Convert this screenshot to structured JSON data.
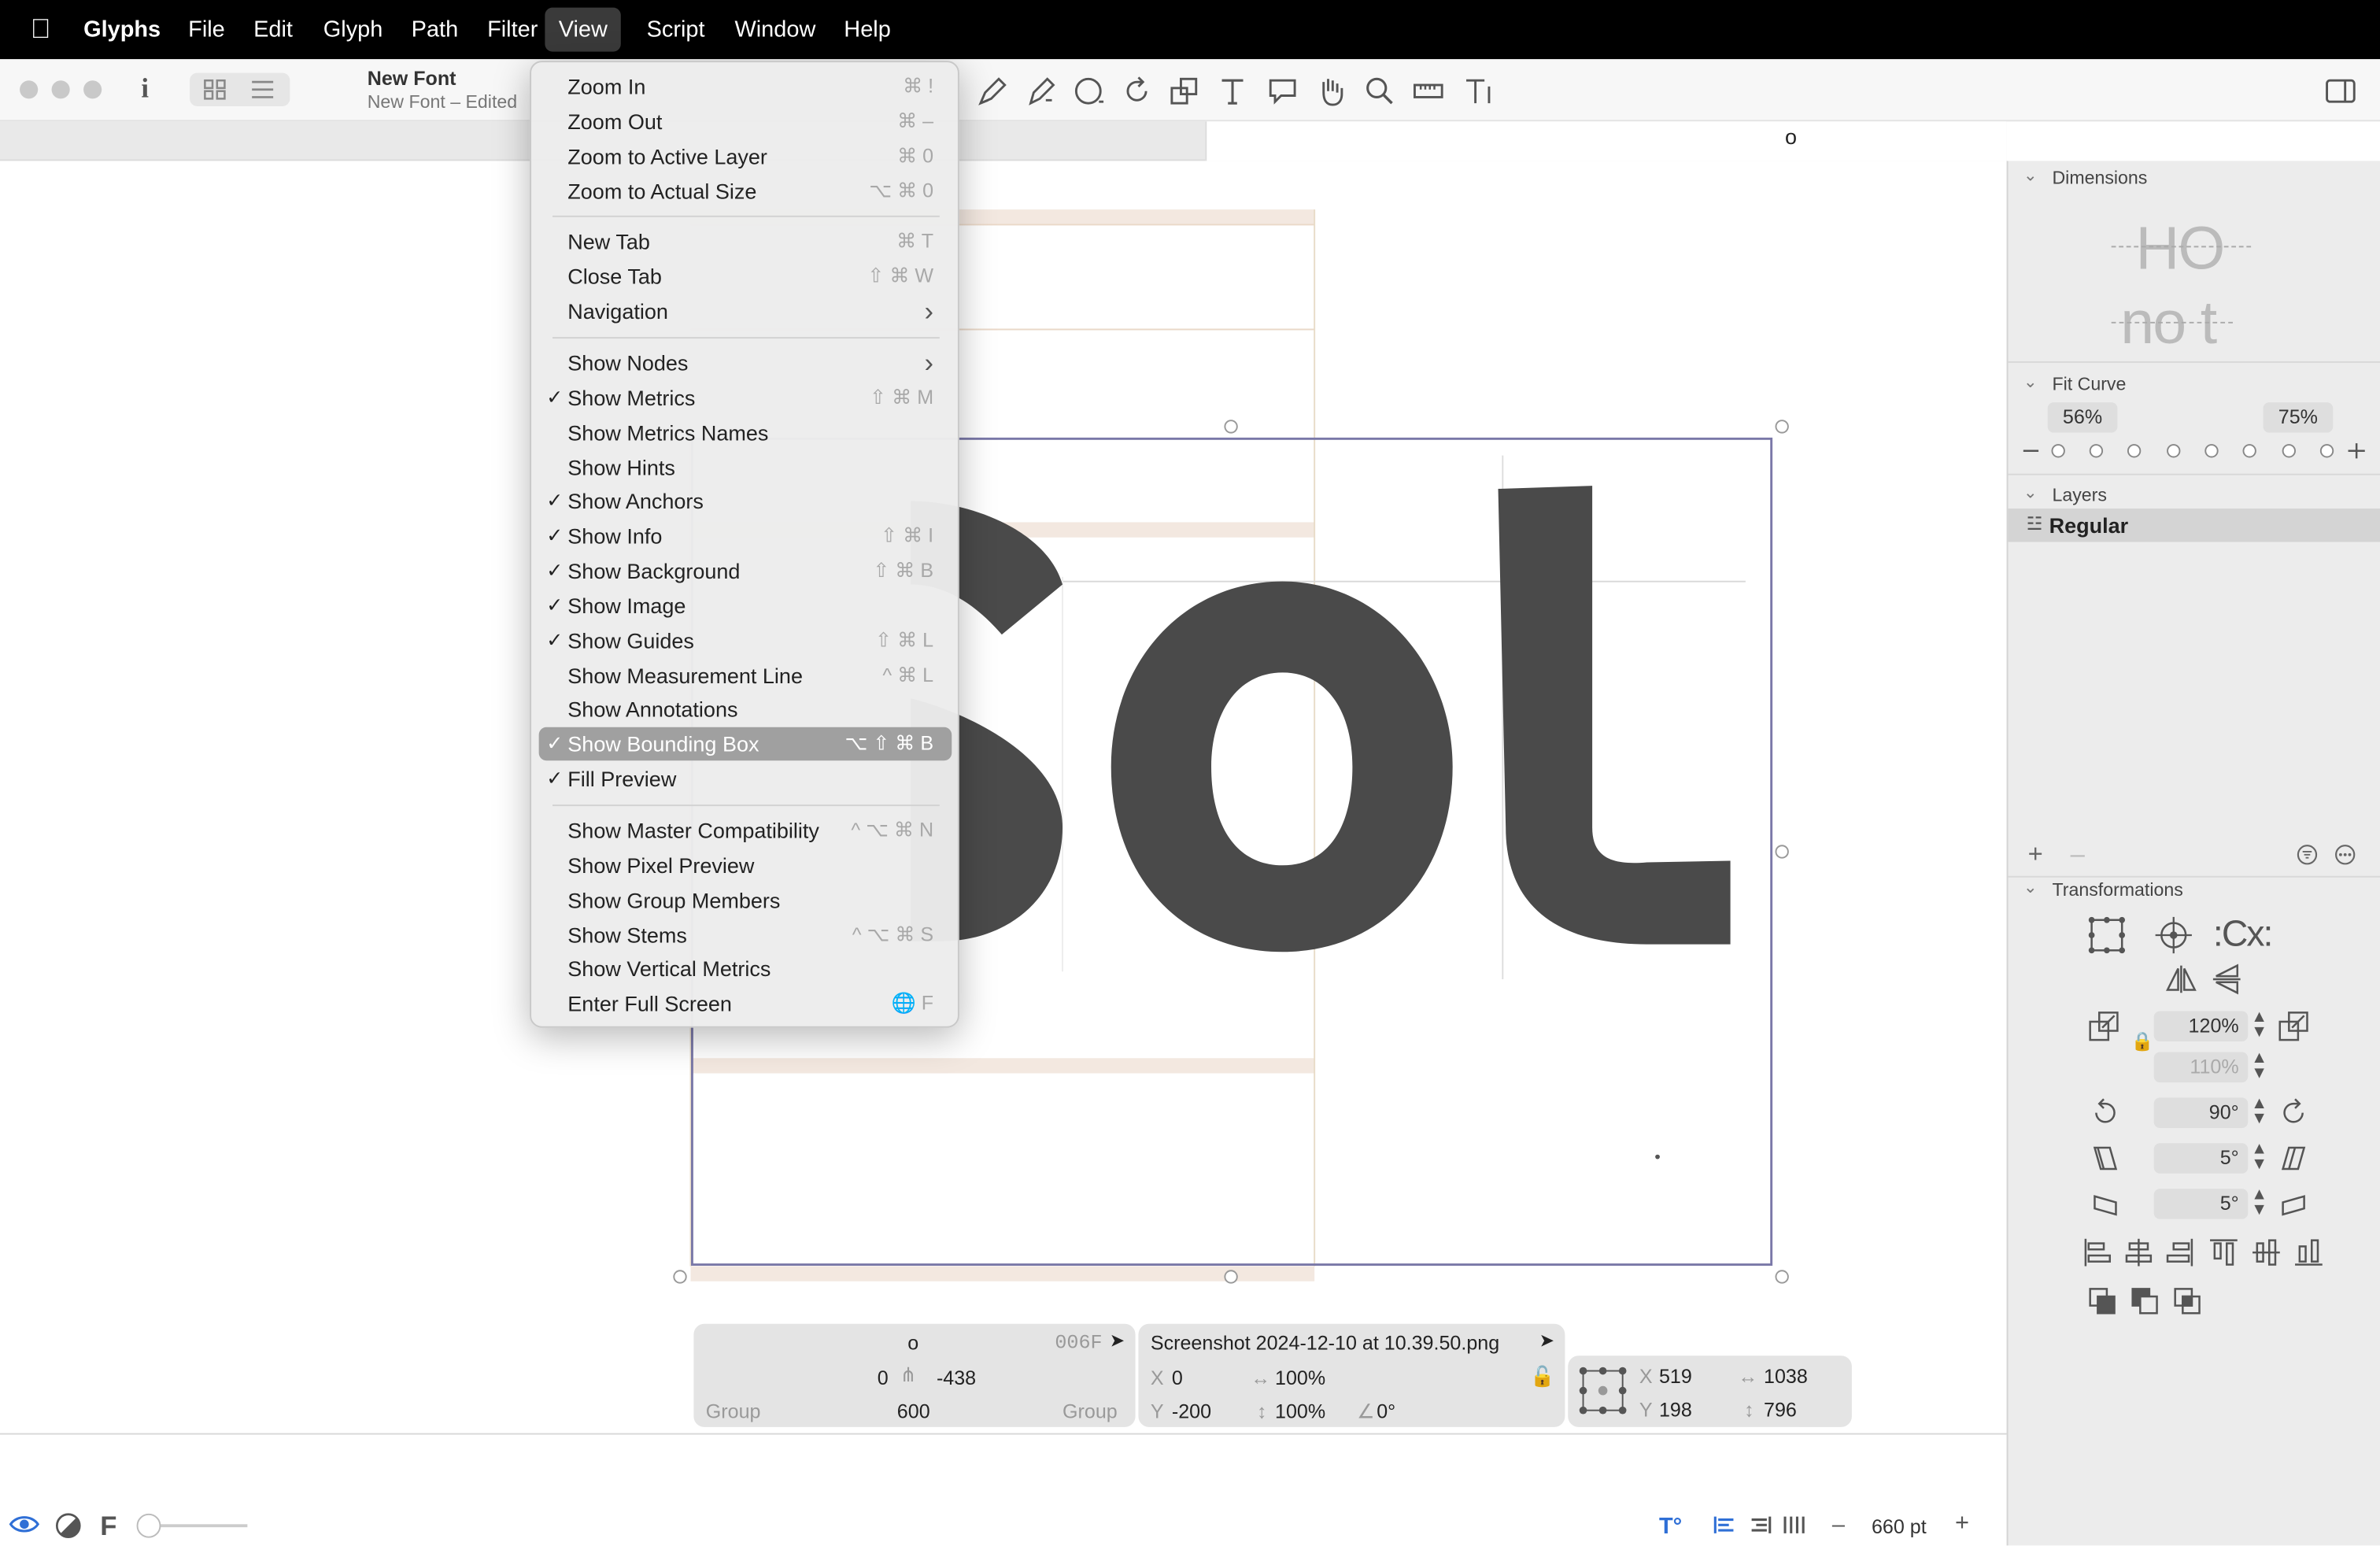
{
  "menubar": {
    "app_name": "Glyphs",
    "items": [
      "File",
      "Edit",
      "Glyph",
      "Path",
      "Filter",
      "View",
      "Script",
      "Window",
      "Help"
    ],
    "selected": "View"
  },
  "window": {
    "title": "New Font",
    "subtitle": "New Font – Edited"
  },
  "tab": {
    "active_text": "o"
  },
  "canvas": {
    "glyph_text": "Sol"
  },
  "view_menu": {
    "items": [
      {
        "label": "Zoom In",
        "shortcut": "⌘ !",
        "checked": false
      },
      {
        "label": "Zoom Out",
        "shortcut": "⌘ –",
        "checked": false
      },
      {
        "label": "Zoom to Active Layer",
        "shortcut": "⌘ 0",
        "checked": false
      },
      {
        "label": "Zoom to Actual Size",
        "shortcut": "⌥ ⌘ 0",
        "checked": false
      },
      {
        "label": "New Tab",
        "shortcut": "⌘ T",
        "checked": false
      },
      {
        "label": "Close Tab",
        "shortcut": "⇧ ⌘ W",
        "checked": false
      },
      {
        "label": "Navigation",
        "shortcut": "",
        "checked": false,
        "submenu": true
      },
      {
        "label": "Show Nodes",
        "shortcut": "",
        "checked": false,
        "submenu": true
      },
      {
        "label": "Show Metrics",
        "shortcut": "⇧ ⌘ M",
        "checked": true
      },
      {
        "label": "Show Metrics Names",
        "shortcut": "",
        "checked": false
      },
      {
        "label": "Show Hints",
        "shortcut": "",
        "checked": false
      },
      {
        "label": "Show Anchors",
        "shortcut": "",
        "checked": true
      },
      {
        "label": "Show Info",
        "shortcut": "⇧ ⌘ I",
        "checked": true
      },
      {
        "label": "Show Background",
        "shortcut": "⇧ ⌘ B",
        "checked": true
      },
      {
        "label": "Show Image",
        "shortcut": "",
        "checked": true
      },
      {
        "label": "Show Guides",
        "shortcut": "⇧ ⌘ L",
        "checked": true
      },
      {
        "label": "Show Measurement Line",
        "shortcut": "^ ⌘ L",
        "checked": false
      },
      {
        "label": "Show Annotations",
        "shortcut": "",
        "checked": false
      },
      {
        "label": "Show Bounding Box",
        "shortcut": "⌥ ⇧ ⌘ B",
        "checked": true,
        "highlighted": true
      },
      {
        "label": "Fill Preview",
        "shortcut": "",
        "checked": true
      },
      {
        "label": "Show Master Compatibility",
        "shortcut": "^ ⌥ ⌘ N",
        "checked": false
      },
      {
        "label": "Show Pixel Preview",
        "shortcut": "",
        "checked": false
      },
      {
        "label": "Show Group Members",
        "shortcut": "",
        "checked": false
      },
      {
        "label": "Show Stems",
        "shortcut": "^ ⌥ ⌘ S",
        "checked": false
      },
      {
        "label": "Show Vertical Metrics",
        "shortcut": "",
        "checked": false
      },
      {
        "label": "Enter Full Screen",
        "shortcut": "🌐 F",
        "checked": false
      }
    ]
  },
  "sidebar": {
    "dimensions_title": "Dimensions",
    "fit_curve_title": "Fit Curve",
    "fit_curve_min": "56%",
    "fit_curve_max": "75%",
    "layers_title": "Layers",
    "layer_name": "Regular",
    "transformations_title": "Transformations",
    "scale_x": "120%",
    "scale_y": "110%",
    "rotate": "90°",
    "slant_1": "5°",
    "slant_2": "5°",
    "dim_preview_top": "HO",
    "dim_preview_bottom": "no t"
  },
  "info_box": {
    "glyph_name": "o",
    "unicode": "006F",
    "lsb": "0",
    "rsb": "-438",
    "left_group": "Group",
    "width": "600",
    "right_group": "Group",
    "image_name": "Screenshot 2024-12-10 at 10.39.50.png",
    "img_x_label": "X",
    "img_x": "0",
    "img_y_label": "Y",
    "img_y": "-200",
    "img_scale_x": "100%",
    "img_scale_y": "100%",
    "img_angle": "0°",
    "sel_x_label": "X",
    "sel_x": "519",
    "sel_y_label": "Y",
    "sel_y": "198",
    "sel_w": "1038",
    "sel_h": "796"
  },
  "bottom": {
    "font_letter": "F",
    "zoom": "660 pt",
    "minus": "–",
    "plus": "+"
  },
  "colors": {
    "menubar_bg": "#000000",
    "highlight": "#a0a0a0",
    "glyph_fill": "#4a4a4a",
    "bbox_stroke": "#7a78a8",
    "metric_band": "#f3e8e0",
    "eye_icon": "#2f6fd6"
  }
}
